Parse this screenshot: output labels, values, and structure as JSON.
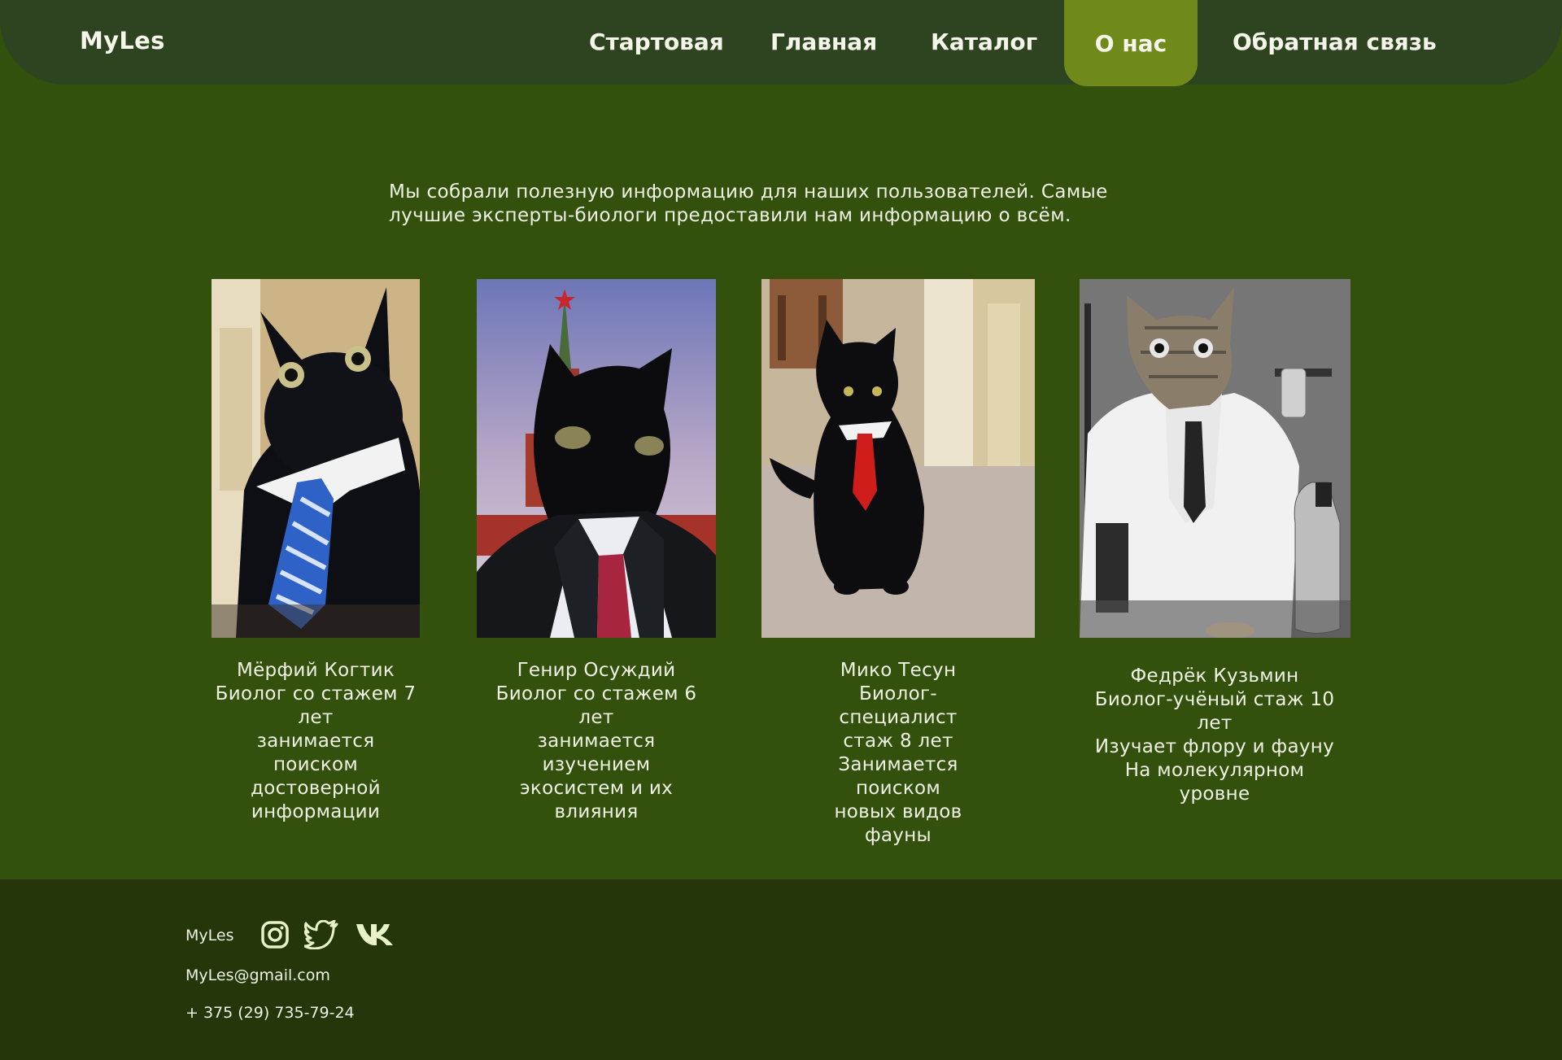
{
  "header": {
    "logo": "MyLes",
    "nav": [
      {
        "label": "Стартовая"
      },
      {
        "label": "Главная"
      },
      {
        "label": "Каталог"
      },
      {
        "label": "О нас",
        "active": true
      },
      {
        "label": "Обратная связь"
      }
    ]
  },
  "intro": {
    "line1": "Мы собрали полезную информацию для наших пользователей. Самые",
    "line2": "лучшие эксперты-биологи предоставили нам информацию о всём."
  },
  "experts": [
    {
      "name": "Мёрфий Когтик",
      "description": "Биолог со стажем 7\nлет\nзанимается\nпоиском\nдостоверной\nинформации"
    },
    {
      "name": "Генир  Осуждий",
      "description": "Биолог со стажем 6\nлет\nзанимается\nизучением\nэкосистем и их\nвлияния"
    },
    {
      "name": "Мико Тесун",
      "description": "Биолог-\nспециалист\nстаж 8 лет\nЗанимается\nпоиском\nновых видов\nфауны"
    },
    {
      "name": "Федрёк Кузьмин",
      "description": "Биолог-учёный стаж 10\nлет\nИзучает флору и фауну\nНа молекулярном\nуровне"
    }
  ],
  "footer": {
    "brand": "MyLes",
    "email": "MyLes@gmail.com",
    "phone": "+ 375 (29) 735-79-24",
    "social": [
      "instagram-icon",
      "twitter-icon",
      "vk-icon"
    ]
  },
  "colors": {
    "background": "#33500c",
    "header": "#2e4320",
    "active_nav": "#6f8a1b",
    "footer": "#25370a",
    "icon": "#e8f2c8"
  }
}
